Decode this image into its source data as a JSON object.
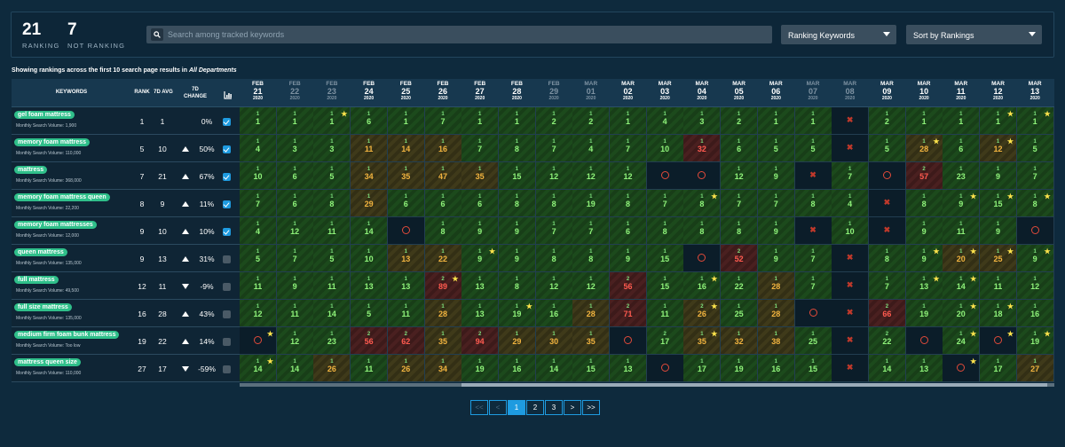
{
  "stats": {
    "ranking": "21",
    "ranking_label": "RANKING",
    "not_ranking": "7",
    "not_ranking_label": "NOT RANKING"
  },
  "search": {
    "placeholder": "Search among tracked keywords"
  },
  "filters": {
    "type": "Ranking Keywords",
    "sort": "Sort by Rankings"
  },
  "caption": {
    "prefix": "Showing rankings across the first 10 search page results in ",
    "dept": "All Departments"
  },
  "headers": {
    "keywords": "KEYWORDS",
    "rank": "RANK",
    "td_avg": "7D AVG",
    "change": "7D CHANGE"
  },
  "dates": [
    {
      "m": "FEB",
      "d": "21",
      "y": "2020",
      "dim": false
    },
    {
      "m": "FEB",
      "d": "22",
      "y": "2020",
      "dim": true
    },
    {
      "m": "FEB",
      "d": "23",
      "y": "2020",
      "dim": true
    },
    {
      "m": "FEB",
      "d": "24",
      "y": "2020",
      "dim": false
    },
    {
      "m": "FEB",
      "d": "25",
      "y": "2020",
      "dim": false
    },
    {
      "m": "FEB",
      "d": "26",
      "y": "2020",
      "dim": false
    },
    {
      "m": "FEB",
      "d": "27",
      "y": "2020",
      "dim": false
    },
    {
      "m": "FEB",
      "d": "28",
      "y": "2020",
      "dim": false
    },
    {
      "m": "FEB",
      "d": "29",
      "y": "2020",
      "dim": true
    },
    {
      "m": "MAR",
      "d": "01",
      "y": "2020",
      "dim": true
    },
    {
      "m": "MAR",
      "d": "02",
      "y": "2020",
      "dim": false
    },
    {
      "m": "MAR",
      "d": "03",
      "y": "2020",
      "dim": false
    },
    {
      "m": "MAR",
      "d": "04",
      "y": "2020",
      "dim": false
    },
    {
      "m": "MAR",
      "d": "05",
      "y": "2020",
      "dim": false
    },
    {
      "m": "MAR",
      "d": "06",
      "y": "2020",
      "dim": false
    },
    {
      "m": "MAR",
      "d": "07",
      "y": "2020",
      "dim": true
    },
    {
      "m": "MAR",
      "d": "08",
      "y": "2020",
      "dim": true
    },
    {
      "m": "MAR",
      "d": "09",
      "y": "2020",
      "dim": false
    },
    {
      "m": "MAR",
      "d": "10",
      "y": "2020",
      "dim": false
    },
    {
      "m": "MAR",
      "d": "11",
      "y": "2020",
      "dim": false
    },
    {
      "m": "MAR",
      "d": "12",
      "y": "2020",
      "dim": false
    },
    {
      "m": "MAR",
      "d": "13",
      "y": "2020",
      "dim": false
    }
  ],
  "rows": [
    {
      "kw": "gel foam mattress",
      "msv": "Monthly Search Volume: 1,900",
      "rank": "1",
      "avg": "1",
      "dir": "none",
      "chg": "0%",
      "checked": true,
      "cells": [
        "g|1|1|",
        "g|1|1|",
        "g|1|1|s",
        "g|1|6|",
        "g|1|1|",
        "g|1|7|",
        "g|1|1|",
        "g|1|1|",
        "g|1|2|",
        "g|1|2|",
        "g|1|1|",
        "g|1|4|",
        "g|1|3|",
        "g|1|2|",
        "g|1|1|",
        "g|1|1|",
        "e|x||",
        "g|1|2|",
        "g|1|1|",
        "g|1|1|",
        "g|1|1|s",
        "g|1|1|s"
      ]
    },
    {
      "kw": "memory foam mattress",
      "msv": "Monthly Search Volume: 110,000",
      "rank": "5",
      "avg": "10",
      "dir": "up",
      "chg": "50%",
      "checked": true,
      "cells": [
        "g|1|4|",
        "g|1|3|",
        "g|1|3|",
        "o|1|11|",
        "o|1|14|",
        "o|1|16|",
        "g|1|7|",
        "g|1|8|",
        "g|1|7|",
        "g|1|4|",
        "g|1|7|",
        "g|1|10|",
        "r|1|32|",
        "g|1|6|",
        "g|1|5|",
        "g|1|5|",
        "e|x||",
        "g|1|5|",
        "o|1|28|s",
        "g|1|6|",
        "o|1|12|s",
        "g|1|5|"
      ]
    },
    {
      "kw": "mattress",
      "msv": "Monthly Search Volume: 368,000",
      "rank": "7",
      "avg": "21",
      "dir": "up",
      "chg": "67%",
      "checked": true,
      "cells": [
        "g|1|10|",
        "g|1|6|",
        "g|1|5|",
        "o|1|34|",
        "o|1|35|",
        "o|1|47|",
        "o|1|35|",
        "g|1|15|",
        "g|1|12|",
        "g|1|12|",
        "g|1|12|",
        "e|o||",
        "e|o||",
        "g|1|12|",
        "g|1|9|",
        "e|x||",
        "g|1|7|",
        "e|o||",
        "r|2|57|",
        "g|1|23|",
        "g|1|9|",
        "g|1|7|"
      ]
    },
    {
      "kw": "memory foam mattress queen",
      "msv": "Monthly Search Volume: 22,200",
      "rank": "8",
      "avg": "9",
      "dir": "up",
      "chg": "11%",
      "checked": true,
      "cells": [
        "g|1|7|",
        "g|1|6|",
        "g|1|8|",
        "o|1|29|",
        "g|1|6|",
        "g|1|6|",
        "g|1|6|",
        "g|1|8|",
        "g|1|8|",
        "g|1|19|",
        "g|1|8|",
        "g|1|7|",
        "g|1|8|s",
        "g|1|7|",
        "g|1|7|",
        "g|1|8|",
        "g|1|4|",
        "e|x||",
        "g|1|8|",
        "g|1|9|s",
        "g|1|15|s",
        "g|1|8|s"
      ]
    },
    {
      "kw": "memory foam mattresses",
      "msv": "Monthly Search Volume: 12,000",
      "rank": "9",
      "avg": "10",
      "dir": "up",
      "chg": "10%",
      "checked": true,
      "cells": [
        "g|1|4|",
        "g|1|12|",
        "g|1|11|",
        "g|1|14|",
        "e|o||",
        "g|1|8|",
        "g|1|9|",
        "g|1|9|",
        "g|1|7|",
        "g|1|7|",
        "g|1|6|",
        "g|1|8|",
        "g|1|8|",
        "g|1|8|",
        "g|1|9|",
        "e|x||",
        "g|1|10|",
        "e|x||",
        "g|1|9|",
        "g|1|11|",
        "g|1|9|",
        "e|o||"
      ]
    },
    {
      "kw": "queen mattress",
      "msv": "Monthly Search Volume: 135,000",
      "rank": "9",
      "avg": "13",
      "dir": "up",
      "chg": "31%",
      "checked": false,
      "cells": [
        "g|1|5|",
        "g|1|7|",
        "g|1|5|",
        "g|1|10|",
        "o|1|13|",
        "o|1|22|",
        "g|1|9|s",
        "g|1|9|",
        "g|1|8|",
        "g|1|8|",
        "g|1|9|",
        "g|1|15|",
        "e|o||",
        "r|2|52|",
        "g|1|9|",
        "g|1|7|",
        "e|x||",
        "g|1|8|",
        "g|1|9|s",
        "o|1|20|s",
        "o|1|25|s",
        "g|1|9|s"
      ]
    },
    {
      "kw": "full mattress",
      "msv": "Monthly Search Volume: 49,500",
      "rank": "12",
      "avg": "11",
      "dir": "down",
      "chg": "-9%",
      "checked": false,
      "cells": [
        "g|1|11|",
        "g|1|9|",
        "g|1|11|",
        "g|1|13|",
        "g|1|13|",
        "r|2|89|s",
        "g|1|13|",
        "g|1|8|",
        "g|1|12|",
        "g|1|12|",
        "r|2|56|",
        "g|1|15|",
        "g|1|16|s",
        "g|1|22|",
        "o|1|28|",
        "g|1|7|",
        "e|x||",
        "g|1|7|",
        "g|1|13|s",
        "g|1|14|s",
        "g|1|11|",
        "g|1|12|"
      ]
    },
    {
      "kw": "full size mattress",
      "msv": "Monthly Search Volume: 135,000",
      "rank": "16",
      "avg": "28",
      "dir": "up",
      "chg": "43%",
      "checked": false,
      "cells": [
        "g|1|12|",
        "g|1|11|",
        "g|1|14|",
        "g|1|5|",
        "g|1|11|",
        "o|1|28|",
        "g|1|13|",
        "g|1|19|s",
        "g|1|16|",
        "o|1|28|",
        "r|2|71|",
        "g|1|11|",
        "o|2|26|s",
        "g|1|25|",
        "o|1|28|",
        "e|o||",
        "e|x||",
        "r|2|66|",
        "g|1|19|",
        "g|1|20|s",
        "g|1|18|s",
        "g|1|16|"
      ]
    },
    {
      "kw": "medium firm foam bunk mattress",
      "msv": "Monthly Search Volume: Too low",
      "rank": "19",
      "avg": "22",
      "dir": "up",
      "chg": "14%",
      "checked": false,
      "cells": [
        "e|o||s",
        "g|1|12|",
        "g|1|23|",
        "r|2|56|",
        "r|2|62|",
        "o|1|35|",
        "r|2|94|",
        "o|1|29|",
        "o|1|30|",
        "o|1|35|",
        "e|o||",
        "g|2|17|",
        "o|1|35|s",
        "o|1|32|",
        "o|1|38|",
        "g|1|25|",
        "e|x||",
        "g|2|22|",
        "e|o||",
        "g|1|24|s",
        "e|o||s",
        "g|1|19|s"
      ]
    },
    {
      "kw": "mattress queen size",
      "msv": "Monthly Search Volume: 110,000",
      "rank": "27",
      "avg": "17",
      "dir": "down",
      "chg": "-59%",
      "checked": false,
      "cells": [
        "g|1|14|s",
        "g|1|14|",
        "o|1|26|",
        "g|1|11|",
        "o|1|26|",
        "o|1|34|",
        "g|1|19|",
        "g|1|16|",
        "g|1|14|",
        "g|1|15|",
        "g|1|13|",
        "e|o||",
        "g|1|17|",
        "g|1|19|",
        "g|1|16|",
        "g|1|15|",
        "e|x||",
        "g|1|14|",
        "g|1|13|",
        "e|o||s",
        "g|1|17|",
        "o|1|27|"
      ]
    }
  ],
  "pagination": {
    "first": "<<",
    "prev": "<",
    "pages": [
      "1",
      "2",
      "3"
    ],
    "next": ">",
    "last": ">>"
  }
}
